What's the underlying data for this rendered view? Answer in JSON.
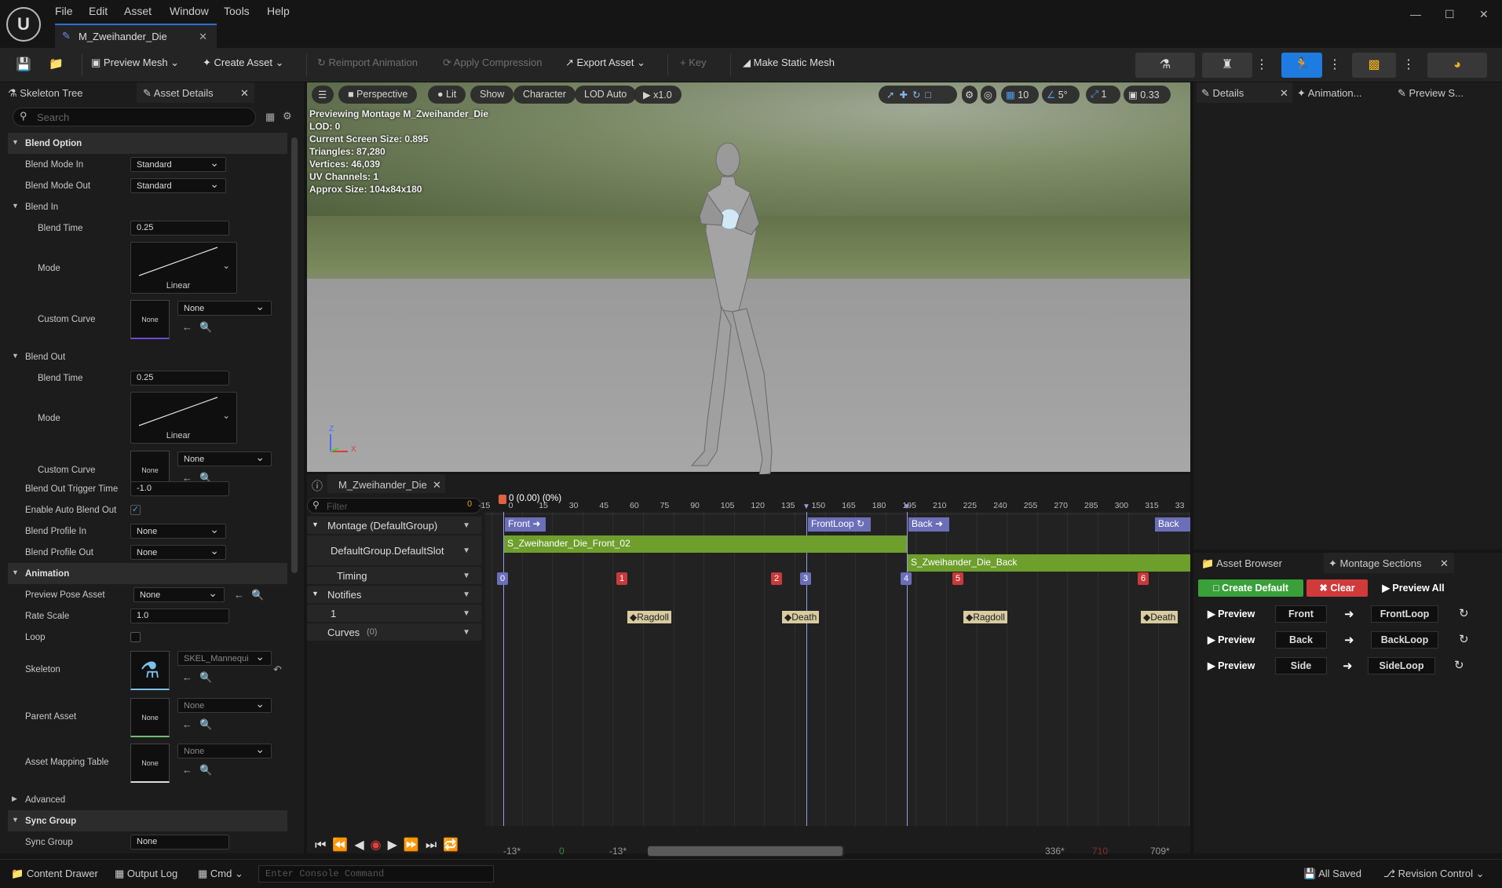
{
  "window": {
    "tab_title": "M_Zweihander_Die",
    "menu": [
      "File",
      "Edit",
      "Asset",
      "Window",
      "Tools",
      "Help"
    ]
  },
  "toolbar": {
    "preview_mesh": "Preview Mesh",
    "create_asset": "Create Asset",
    "reimport": "Reimport Animation",
    "apply_compression": "Apply Compression",
    "export_asset": "Export Asset",
    "key": "Key",
    "make_static_mesh": "Make Static Mesh"
  },
  "left_panel": {
    "tabs": [
      "Skeleton Tree",
      "Asset Details"
    ],
    "search_placeholder": "Search",
    "blend_option": "Blend Option",
    "blend_mode_in": {
      "label": "Blend Mode In",
      "value": "Standard"
    },
    "blend_mode_out": {
      "label": "Blend Mode Out",
      "value": "Standard"
    },
    "blend_in": "Blend In",
    "blend_in_time": {
      "label": "Blend Time",
      "value": "0.25"
    },
    "blend_in_mode": {
      "label": "Mode",
      "value": "Linear"
    },
    "blend_in_curve": {
      "label": "Custom Curve",
      "thumb": "None",
      "value": "None"
    },
    "blend_out": "Blend Out",
    "blend_out_time": {
      "label": "Blend Time",
      "value": "0.25"
    },
    "blend_out_mode": {
      "label": "Mode",
      "value": "Linear"
    },
    "blend_out_curve": {
      "label": "Custom Curve",
      "thumb": "None",
      "value": "None"
    },
    "blend_out_trigger": {
      "label": "Blend Out Trigger Time",
      "value": "-1.0"
    },
    "auto_blend_out": {
      "label": "Enable Auto Blend Out",
      "checked": true
    },
    "profile_in": {
      "label": "Blend Profile In",
      "value": "None"
    },
    "profile_out": {
      "label": "Blend Profile Out",
      "value": "None"
    },
    "animation": "Animation",
    "preview_pose": {
      "label": "Preview Pose Asset",
      "value": "None"
    },
    "rate_scale": {
      "label": "Rate Scale",
      "value": "1.0"
    },
    "loop": {
      "label": "Loop",
      "checked": false
    },
    "skeleton": {
      "label": "Skeleton",
      "value": "SKEL_Mannequi"
    },
    "parent_asset": {
      "label": "Parent Asset",
      "thumb": "None",
      "value": "None"
    },
    "mapping_table": {
      "label": "Asset Mapping Table",
      "thumb": "None",
      "value": "None"
    },
    "advanced": "Advanced",
    "sync_group_cat": "Sync Group",
    "sync_group": {
      "label": "Sync Group",
      "value": "None"
    }
  },
  "viewport": {
    "buttons": [
      "Perspective",
      "Lit",
      "Show",
      "Character",
      "LOD Auto",
      "x1.0"
    ],
    "grid": "10",
    "angle": "5°",
    "scale": "1",
    "camera": "0.33",
    "stats": [
      "Previewing Montage M_Zweihander_Die",
      "LOD: 0",
      "Current Screen Size: 0.895",
      "Triangles: 87,280",
      "Vertices: 46,039",
      "UV Channels: 1",
      "Approx Size: 104x84x180"
    ],
    "axis_z": "Z",
    "axis_x": "X"
  },
  "right_top": {
    "tabs": [
      "Details",
      "Animation...",
      "Preview S..."
    ]
  },
  "right_bottom": {
    "tabs": [
      "Asset Browser",
      "Montage Sections"
    ],
    "create_default": "Create Default",
    "clear": "Clear",
    "preview_all": "Preview All",
    "preview": "Preview",
    "rows": [
      {
        "from": "Front",
        "to": "FrontLoop"
      },
      {
        "from": "Back",
        "to": "BackLoop"
      },
      {
        "from": "Side",
        "to": "SideLoop"
      }
    ]
  },
  "timeline": {
    "tab": "M_Zweihander_Die",
    "filter_placeholder": "Filter",
    "filter_count": "0",
    "playhead_label": "0 (0.00) (0%)",
    "ticks": [
      "-15",
      "0",
      "15",
      "30",
      "45",
      "60",
      "75",
      "90",
      "105",
      "120",
      "135",
      "150",
      "165",
      "180",
      "195",
      "210",
      "225",
      "240",
      "255",
      "270",
      "285",
      "300",
      "315",
      "33"
    ],
    "tracks": {
      "montage": "Montage (DefaultGroup)",
      "slot": "DefaultGroup.DefaultSlot",
      "timing": "Timing",
      "notifies": "Notifies",
      "notify_track": "1",
      "curves": "Curves",
      "curves_count": "(0)"
    },
    "sections": [
      "Front",
      "FrontLoop",
      "Back",
      "Back"
    ],
    "segments": [
      "S_Zweihander_Die_Front_02",
      "S_Zweihander_Die_Back"
    ],
    "timing_markers": [
      "0",
      "1",
      "2",
      "3",
      "4",
      "5",
      "6"
    ],
    "notifies": [
      "Ragdoll",
      "Death",
      "Ragdoll",
      "Death"
    ],
    "range": {
      "left_start": "-13*",
      "left_mid": "0",
      "left_end": "-13*",
      "right_start": "336*",
      "right_mid": "710",
      "right_end": "709*"
    }
  },
  "statusbar": {
    "content_drawer": "Content Drawer",
    "output_log": "Output Log",
    "cmd": "Cmd",
    "console_placeholder": "Enter Console Command",
    "all_saved": "All Saved",
    "revision_control": "Revision Control"
  }
}
